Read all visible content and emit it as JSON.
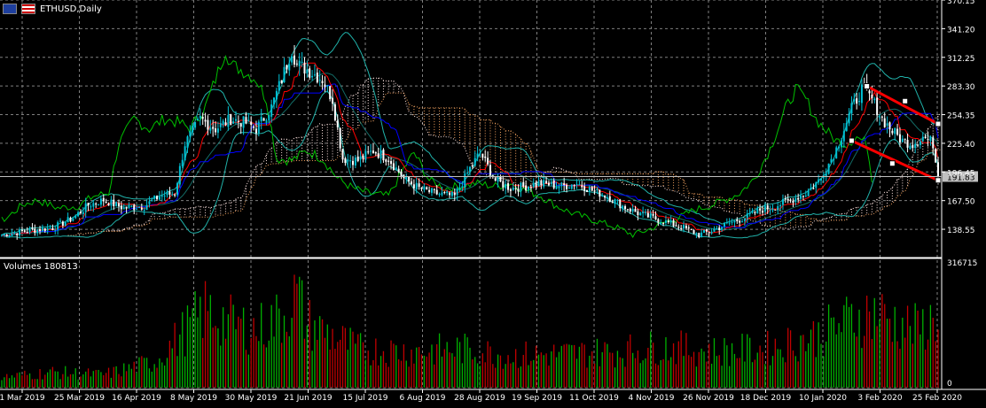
{
  "header": {
    "symbol_title": "ETHUSD,Daily",
    "flag1": "eu-flag-icon",
    "flag2": "us-flag-icon"
  },
  "colors": {
    "background": "#000000",
    "grid": "#7f7f7f",
    "bull": "#00c2d6",
    "bear": "#ffffff",
    "bb": "#20b2aa",
    "tenkan": "#ff0000",
    "kijun": "#0000ff",
    "chikou": "#00c000",
    "kumo_a": "#f4a460",
    "kumo_b": "#ffe4e1",
    "vol_up": "#00b000",
    "vol_down": "#c00000",
    "channel": "#ff0000",
    "price_marker_bg": "#c0c0c0"
  },
  "volume_panel": {
    "title": "Volumes 180813",
    "max_label": "316715",
    "zero_label": "0"
  },
  "chart_data": {
    "type": "candlestick",
    "title": "ETHUSD,Daily",
    "y_ticks": [
      "370.15",
      "341.20",
      "312.25",
      "283.30",
      "254.35",
      "225.40",
      "196.45",
      "167.50",
      "138.55"
    ],
    "ylim": [
      110,
      370.15
    ],
    "current_price": "191.83",
    "x_labels": [
      "1 Mar 2019",
      "25 Mar 2019",
      "16 Apr 2019",
      "8 May 2019",
      "30 May 2019",
      "21 Jun 2019",
      "15 Jul 2019",
      "6 Aug 2019",
      "28 Aug 2019",
      "19 Sep 2019",
      "11 Oct 2019",
      "4 Nov 2019",
      "26 Nov 2019",
      "18 Dec 2019",
      "10 Jan 2020",
      "3 Feb 2020",
      "25 Feb 2020"
    ],
    "close_keypoints": [
      [
        0,
        133
      ],
      [
        10,
        137
      ],
      [
        20,
        140
      ],
      [
        28,
        150
      ],
      [
        34,
        163
      ],
      [
        40,
        168
      ],
      [
        48,
        160
      ],
      [
        56,
        162
      ],
      [
        62,
        172
      ],
      [
        68,
        175
      ],
      [
        72,
        225
      ],
      [
        78,
        250
      ],
      [
        84,
        240
      ],
      [
        90,
        250
      ],
      [
        96,
        246
      ],
      [
        100,
        240
      ],
      [
        106,
        262
      ],
      [
        110,
        290
      ],
      [
        114,
        320
      ],
      [
        116,
        305
      ],
      [
        120,
        300
      ],
      [
        126,
        290
      ],
      [
        130,
        270
      ],
      [
        134,
        210
      ],
      [
        140,
        208
      ],
      [
        146,
        218
      ],
      [
        152,
        210
      ],
      [
        158,
        190
      ],
      [
        164,
        180
      ],
      [
        170,
        175
      ],
      [
        178,
        172
      ],
      [
        184,
        200
      ],
      [
        188,
        216
      ],
      [
        194,
        188
      ],
      [
        200,
        180
      ],
      [
        206,
        182
      ],
      [
        212,
        185
      ],
      [
        220,
        182
      ],
      [
        226,
        185
      ],
      [
        232,
        178
      ],
      [
        238,
        172
      ],
      [
        244,
        162
      ],
      [
        250,
        155
      ],
      [
        256,
        150
      ],
      [
        262,
        145
      ],
      [
        268,
        140
      ],
      [
        274,
        133
      ],
      [
        280,
        138
      ],
      [
        286,
        145
      ],
      [
        292,
        150
      ],
      [
        298,
        158
      ],
      [
        304,
        162
      ],
      [
        310,
        168
      ],
      [
        316,
        175
      ],
      [
        322,
        190
      ],
      [
        328,
        220
      ],
      [
        334,
        260
      ],
      [
        338,
        280
      ],
      [
        342,
        270
      ],
      [
        346,
        250
      ],
      [
        350,
        238
      ],
      [
        354,
        228
      ],
      [
        358,
        225
      ],
      [
        362,
        232
      ],
      [
        366,
        225
      ],
      [
        368,
        190
      ]
    ],
    "volume_keypoints": [
      [
        0,
        8
      ],
      [
        20,
        12
      ],
      [
        40,
        10
      ],
      [
        60,
        20
      ],
      [
        70,
        40
      ],
      [
        80,
        60
      ],
      [
        90,
        50
      ],
      [
        100,
        45
      ],
      [
        110,
        55
      ],
      [
        116,
        72
      ],
      [
        120,
        50
      ],
      [
        130,
        40
      ],
      [
        140,
        30
      ],
      [
        160,
        28
      ],
      [
        180,
        30
      ],
      [
        200,
        25
      ],
      [
        220,
        26
      ],
      [
        240,
        28
      ],
      [
        260,
        32
      ],
      [
        280,
        28
      ],
      [
        300,
        30
      ],
      [
        320,
        40
      ],
      [
        336,
        55
      ],
      [
        344,
        58
      ],
      [
        352,
        50
      ],
      [
        360,
        45
      ],
      [
        368,
        55
      ]
    ],
    "series": [
      {
        "name": "price",
        "type": "candlestick"
      },
      {
        "name": "bollinger",
        "type": "band"
      },
      {
        "name": "ichimoku",
        "type": "cloud"
      },
      {
        "name": "volume",
        "type": "bar"
      }
    ],
    "channel": {
      "upper": [
        [
          340,
          283
        ],
        [
          368,
          245
        ]
      ],
      "lower": [
        [
          334,
          228
        ],
        [
          368,
          188
        ]
      ],
      "points": [
        [
          340,
          283
        ],
        [
          355,
          268
        ],
        [
          368,
          245
        ],
        [
          334,
          228
        ],
        [
          350,
          205
        ],
        [
          368,
          188
        ]
      ]
    }
  }
}
